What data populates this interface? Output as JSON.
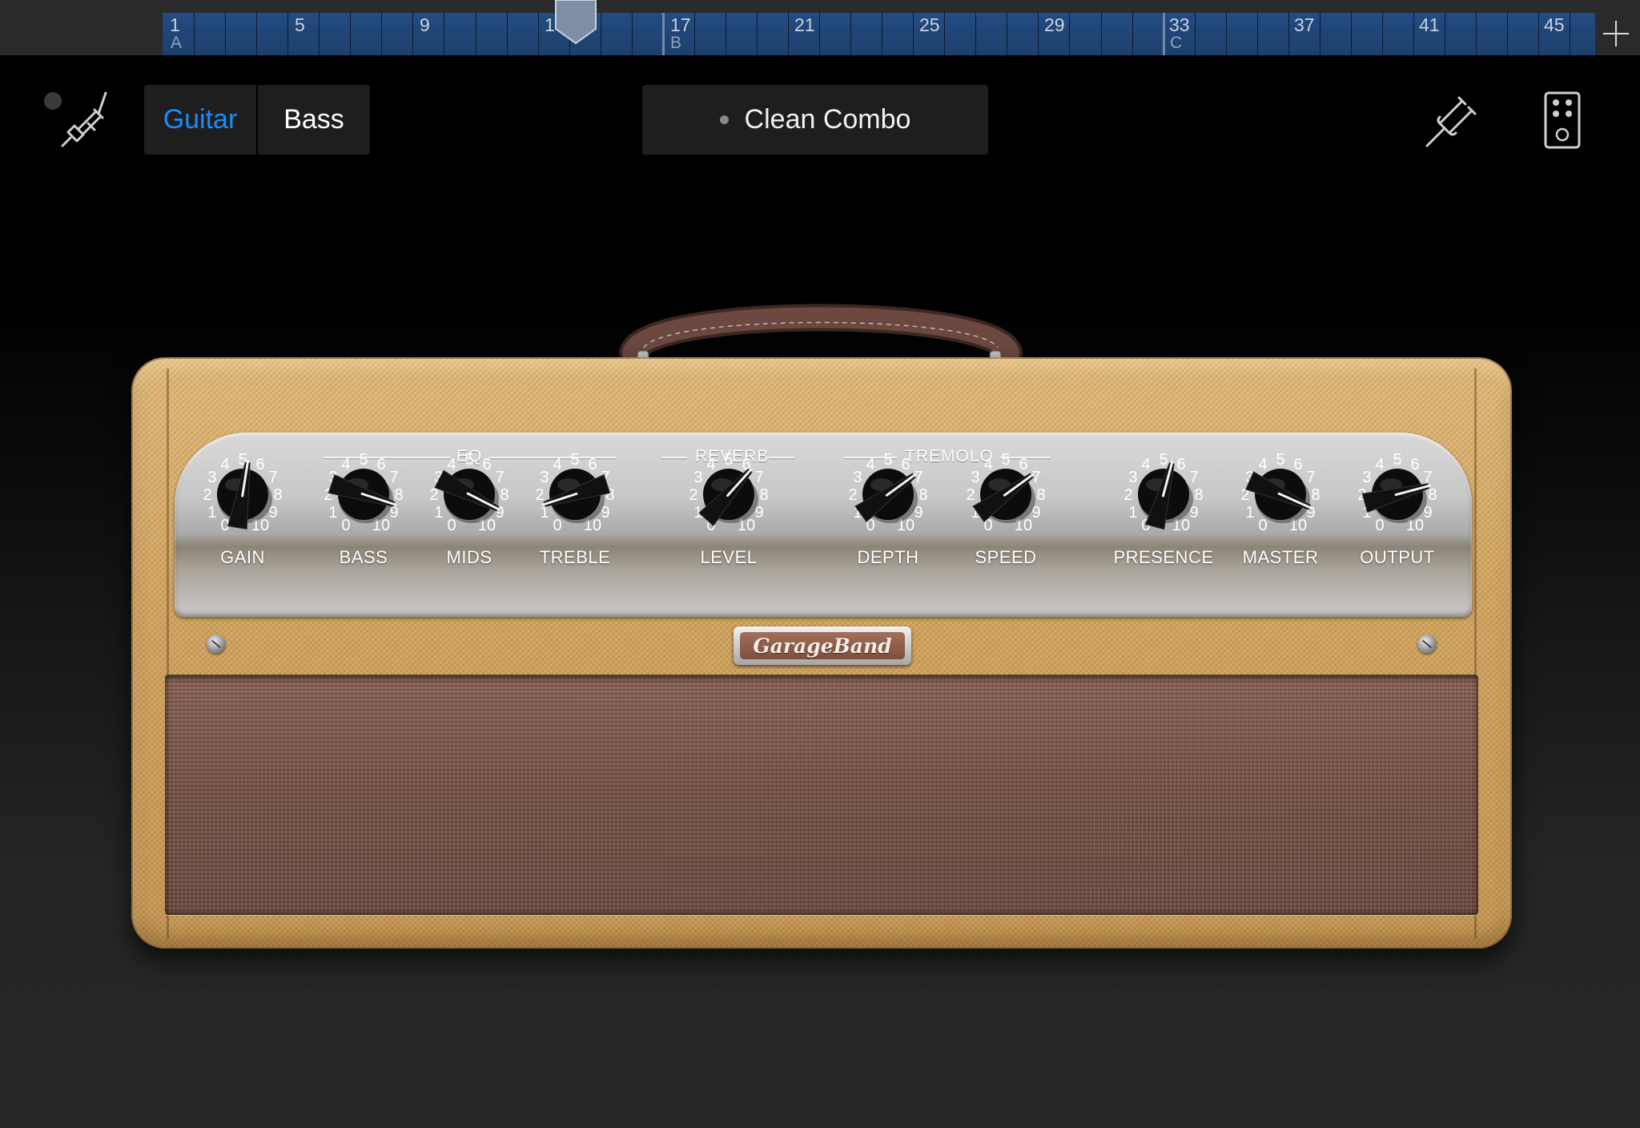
{
  "ruler": {
    "bars": [
      "1",
      "5",
      "9",
      "13",
      "17",
      "21",
      "25",
      "29",
      "33",
      "37",
      "41",
      "45"
    ],
    "sections": [
      "A",
      "B",
      "C"
    ]
  },
  "toolbar": {
    "instrument_tabs": [
      "Guitar",
      "Bass"
    ],
    "selected_tab": "Guitar",
    "preset_name": "Clean Combo",
    "accent_color": "#1a8cff"
  },
  "icons": {
    "input": "guitar-cable-icon",
    "tuner": "tuning-fork-icon",
    "pedalboard": "stompbox-icon",
    "add": "plus-icon",
    "playhead": "playhead-icon"
  },
  "amp": {
    "groups": {
      "eq": "EQ",
      "reverb": "REVERB",
      "tremolo": "TREMOLO"
    },
    "scale": [
      "0",
      "1",
      "2",
      "3",
      "4",
      "5",
      "6",
      "7",
      "8",
      "9",
      "10"
    ],
    "knobs": [
      {
        "label": "GAIN",
        "value": 5.3
      },
      {
        "label": "BASS",
        "value": 8.6
      },
      {
        "label": "MIDS",
        "value": 8.9
      },
      {
        "label": "TREBLE",
        "value": 1.4
      },
      {
        "label": "LEVEL",
        "value": 6.4
      },
      {
        "label": "DEPTH",
        "value": 6.8
      },
      {
        "label": "SPEED",
        "value": 6.8
      },
      {
        "label": "PRESENCE",
        "value": 5.5
      },
      {
        "label": "MASTER",
        "value": 8.8
      },
      {
        "label": "OUTPUT",
        "value": 7.5
      }
    ],
    "logo": "GarageBand"
  }
}
